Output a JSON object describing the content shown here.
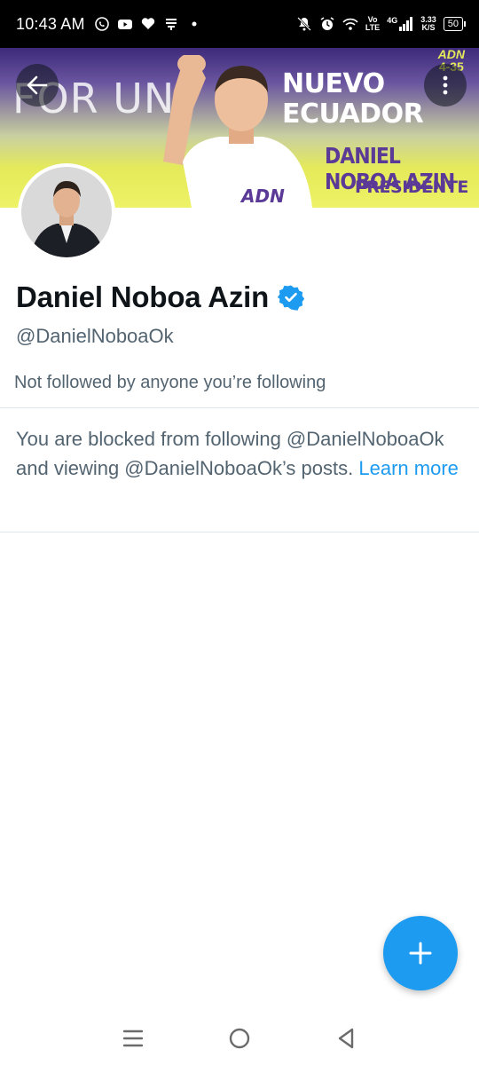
{
  "status_bar": {
    "time": "10:43 AM",
    "network_label_top": "Vo",
    "network_label_bottom": "LTE",
    "signal_label": "4G",
    "speed_value": "3.33",
    "speed_unit": "K/S",
    "battery": "50"
  },
  "banner": {
    "text_left": "FOR UN",
    "text_right_line1": "NUEVO",
    "text_right_line2": "ECUADOR",
    "candidate_name": "DANIEL NOBOA AZIN",
    "candidate_role": "PRESIDENTE",
    "logo_text": "ADN",
    "corner_logo": "ADN",
    "corner_list": "4-35"
  },
  "profile": {
    "name": "Daniel Noboa Azin",
    "handle": "@DanielNoboaOk",
    "followed_by": "Not followed by anyone you’re following",
    "verified": true
  },
  "blocked_notice": {
    "text": "You are blocked from following @DanielNoboaOk and viewing @DanielNoboaOk’s posts.",
    "link": "Learn more"
  },
  "colors": {
    "accent": "#1d9bf0",
    "secondary_text": "#536471",
    "primary_text": "#0f1419",
    "banner_purple": "#5a3a96",
    "banner_yellow": "#e4ea5a"
  },
  "icons": {
    "back": "arrow-left-icon",
    "more": "more-vertical-icon",
    "verified": "verified-badge-icon",
    "compose": "plus-icon",
    "nav_recents": "menu-lines-icon",
    "nav_home": "circle-home-icon",
    "nav_back": "triangle-back-icon"
  }
}
